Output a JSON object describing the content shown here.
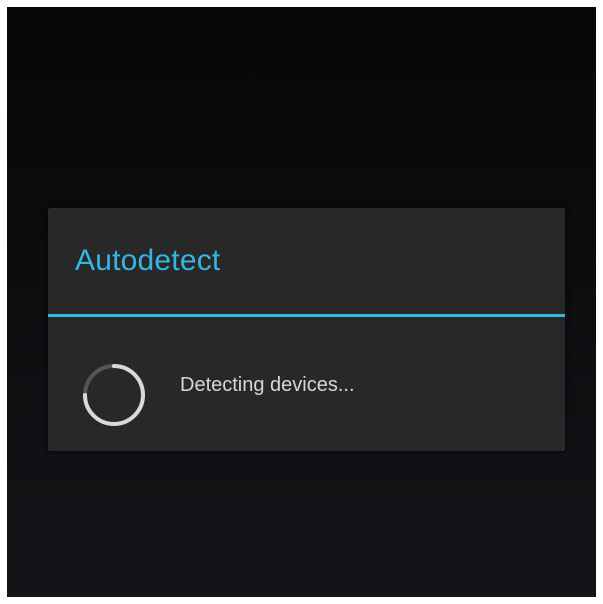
{
  "dialog": {
    "title": "Autodetect",
    "message": "Detecting devices...",
    "accent_color": "#33b5e5",
    "progress_icon": "indeterminate-spinner-icon"
  }
}
